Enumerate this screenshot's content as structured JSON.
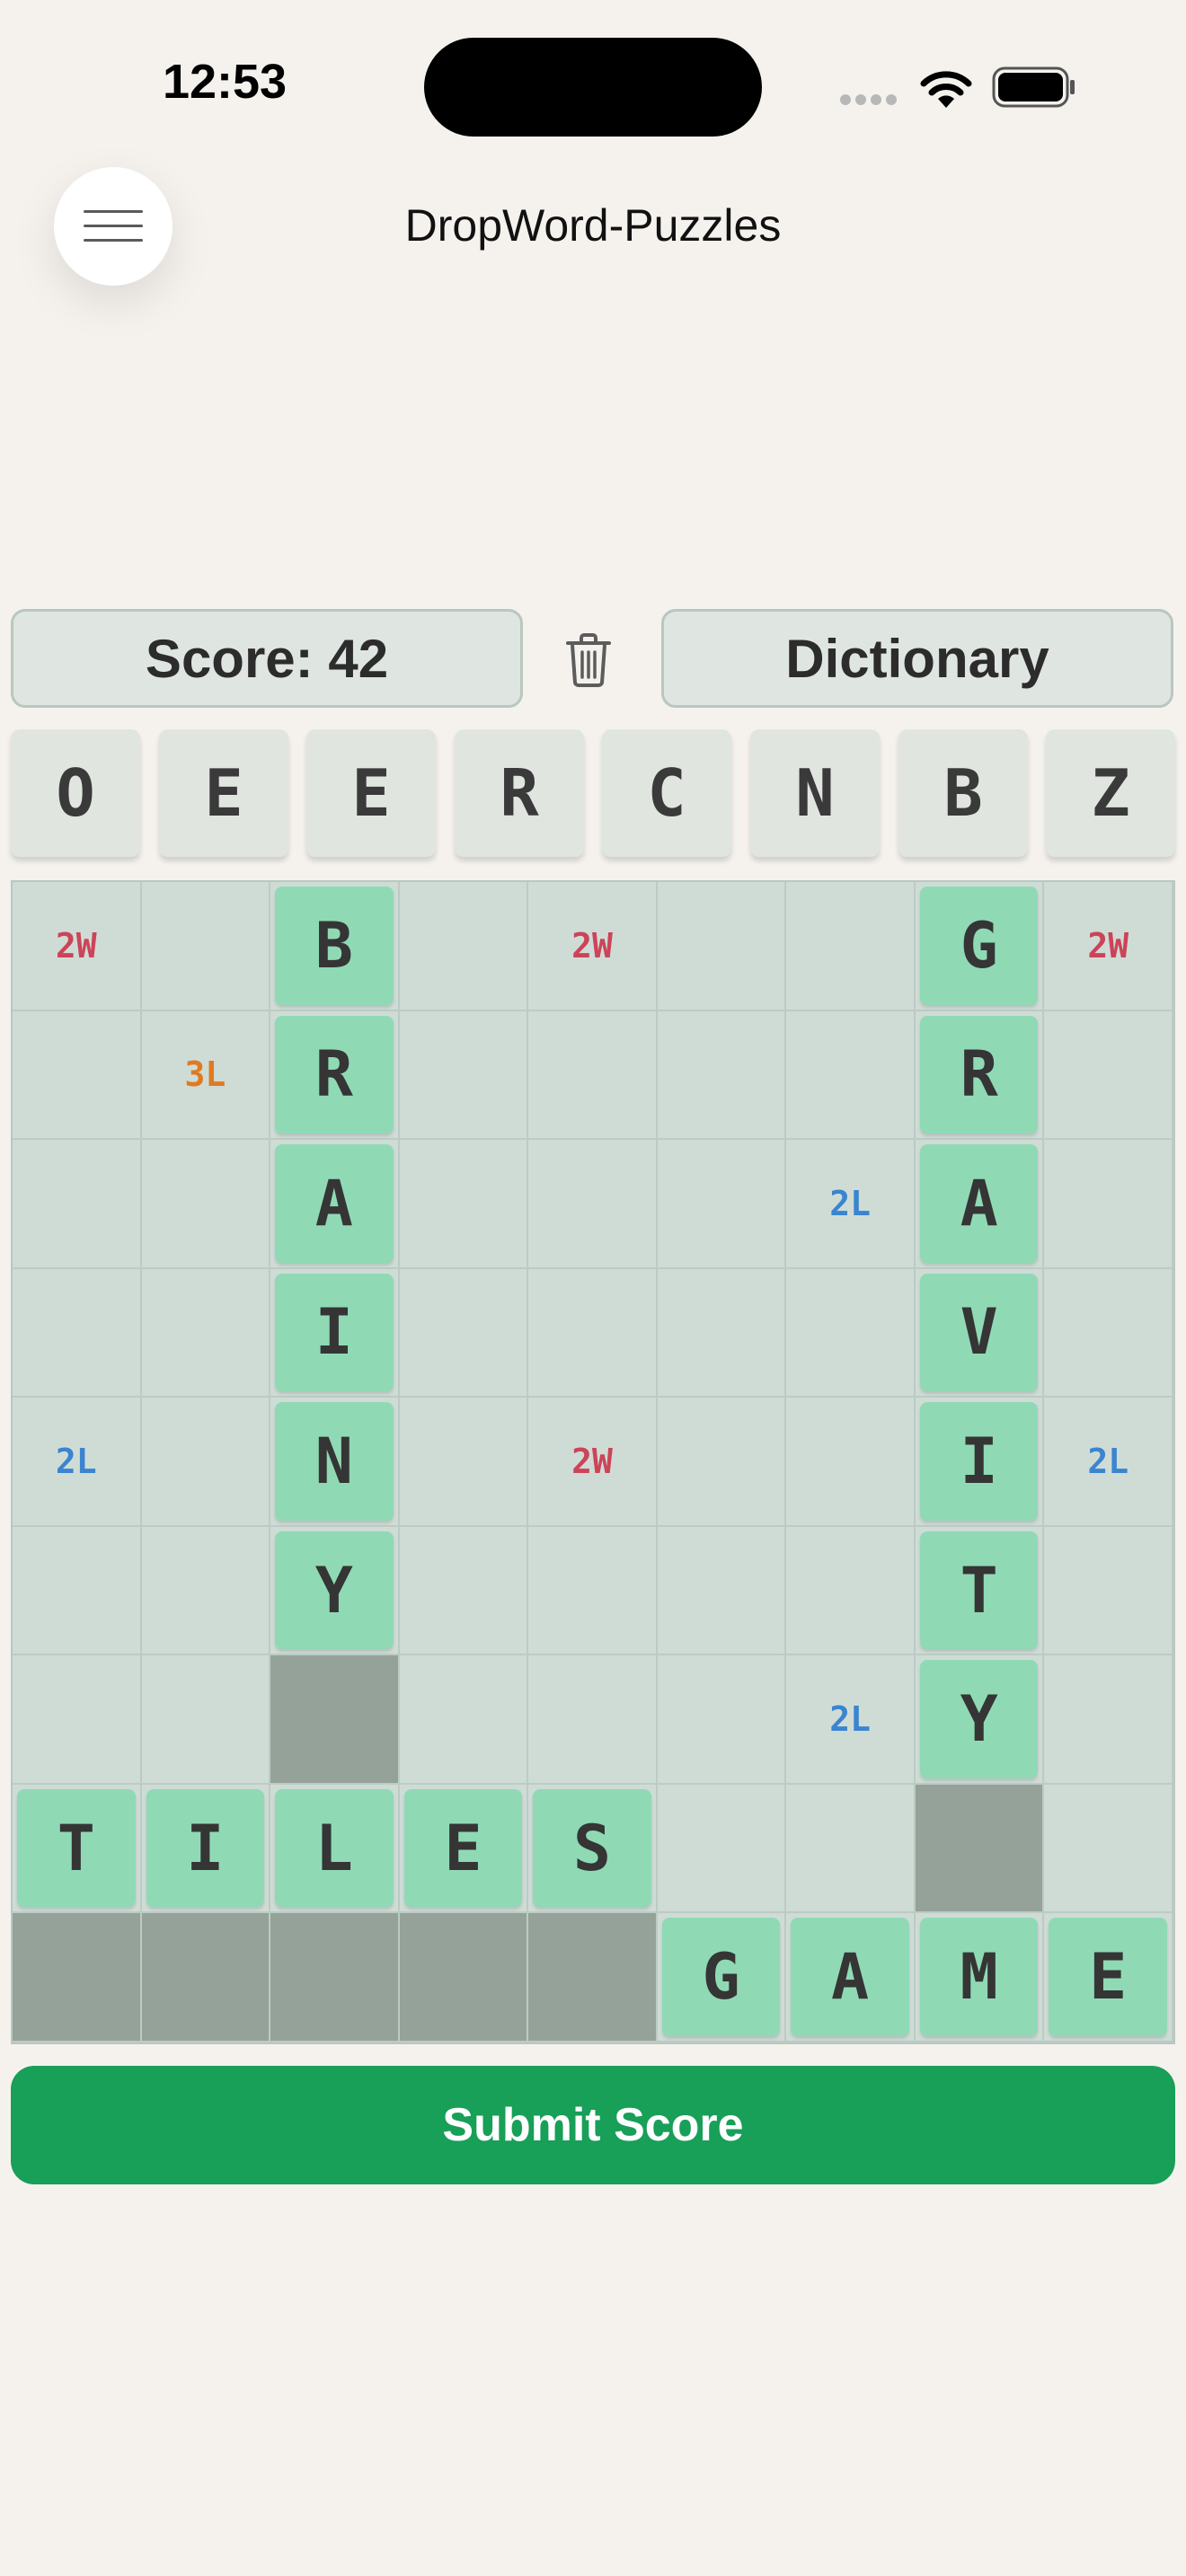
{
  "status_bar": {
    "time": "12:53"
  },
  "header": {
    "title": "DropWord-Puzzles",
    "menu_icon": "hamburger-icon"
  },
  "controls": {
    "score_label": "Score: 42",
    "trash_icon": "trash-icon",
    "dictionary_label": "Dictionary"
  },
  "rack": {
    "letters": [
      "O",
      "E",
      "E",
      "R",
      "C",
      "N",
      "B",
      "Z"
    ]
  },
  "board": {
    "size": 9,
    "bonus_colors": {
      "2W": "#cc4458",
      "3L": "#e07a22",
      "2L": "#3b84cf"
    },
    "cells": [
      {
        "row": 0,
        "col": 0,
        "bonus": "2W"
      },
      {
        "row": 0,
        "col": 2,
        "letter": "B"
      },
      {
        "row": 0,
        "col": 4,
        "bonus": "2W"
      },
      {
        "row": 0,
        "col": 7,
        "letter": "G"
      },
      {
        "row": 0,
        "col": 8,
        "bonus": "2W"
      },
      {
        "row": 1,
        "col": 1,
        "bonus": "3L"
      },
      {
        "row": 1,
        "col": 2,
        "letter": "R"
      },
      {
        "row": 1,
        "col": 7,
        "letter": "R"
      },
      {
        "row": 2,
        "col": 2,
        "letter": "A"
      },
      {
        "row": 2,
        "col": 6,
        "bonus": "2L"
      },
      {
        "row": 2,
        "col": 7,
        "letter": "A"
      },
      {
        "row": 3,
        "col": 2,
        "letter": "I"
      },
      {
        "row": 3,
        "col": 7,
        "letter": "V"
      },
      {
        "row": 4,
        "col": 0,
        "bonus": "2L"
      },
      {
        "row": 4,
        "col": 2,
        "letter": "N"
      },
      {
        "row": 4,
        "col": 4,
        "bonus": "2W"
      },
      {
        "row": 4,
        "col": 7,
        "letter": "I"
      },
      {
        "row": 4,
        "col": 8,
        "bonus": "2L"
      },
      {
        "row": 5,
        "col": 2,
        "letter": "Y"
      },
      {
        "row": 5,
        "col": 7,
        "letter": "T"
      },
      {
        "row": 6,
        "col": 2,
        "blocked": true
      },
      {
        "row": 6,
        "col": 6,
        "bonus": "2L"
      },
      {
        "row": 6,
        "col": 7,
        "letter": "Y"
      },
      {
        "row": 7,
        "col": 0,
        "letter": "T"
      },
      {
        "row": 7,
        "col": 1,
        "letter": "I"
      },
      {
        "row": 7,
        "col": 2,
        "letter": "L"
      },
      {
        "row": 7,
        "col": 3,
        "letter": "E"
      },
      {
        "row": 7,
        "col": 4,
        "letter": "S"
      },
      {
        "row": 7,
        "col": 7,
        "blocked": true
      },
      {
        "row": 8,
        "col": 0,
        "blocked": true
      },
      {
        "row": 8,
        "col": 1,
        "blocked": true
      },
      {
        "row": 8,
        "col": 2,
        "blocked": true
      },
      {
        "row": 8,
        "col": 3,
        "blocked": true
      },
      {
        "row": 8,
        "col": 4,
        "blocked": true
      },
      {
        "row": 8,
        "col": 5,
        "letter": "G"
      },
      {
        "row": 8,
        "col": 6,
        "letter": "A"
      },
      {
        "row": 8,
        "col": 7,
        "letter": "M"
      },
      {
        "row": 8,
        "col": 8,
        "letter": "E"
      }
    ]
  },
  "submit": {
    "label": "Submit Score"
  }
}
